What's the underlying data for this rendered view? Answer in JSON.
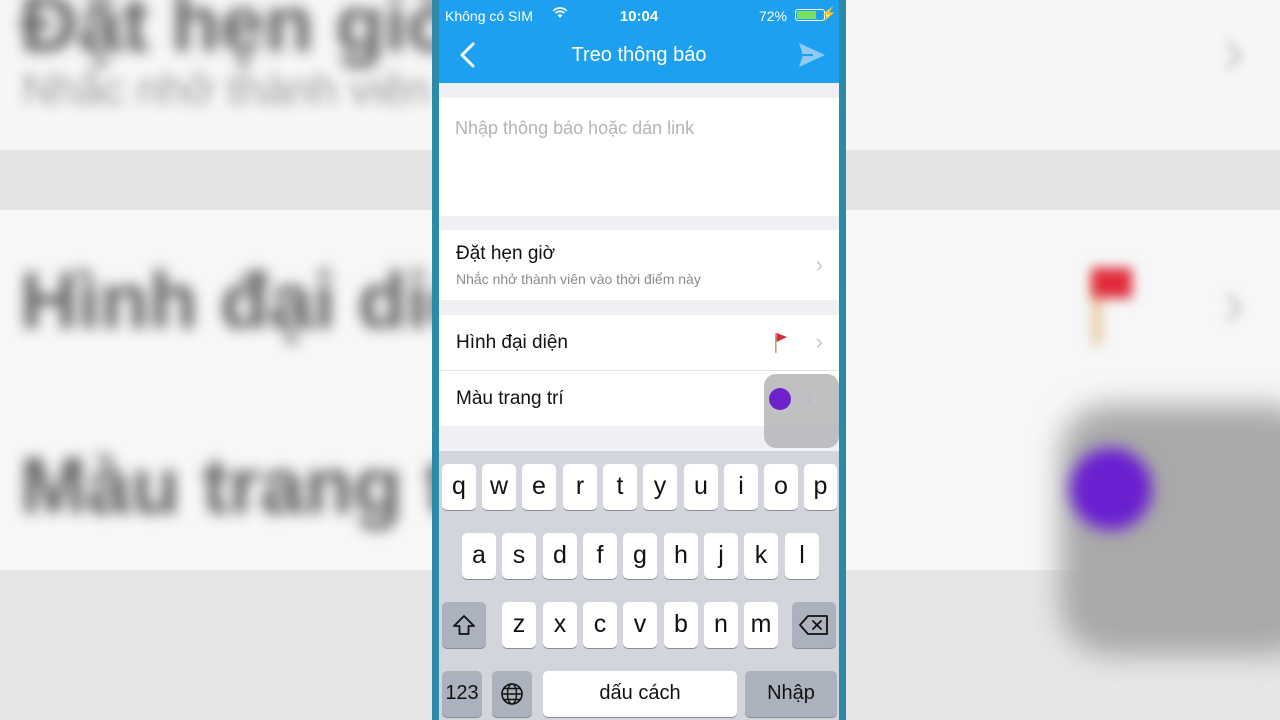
{
  "status_bar": {
    "carrier": "Không có SIM",
    "time": "10:04",
    "battery_percent": "72%",
    "battery_level": 0.72
  },
  "nav": {
    "title": "Treo thông báo",
    "back_icon": "chevron-left-icon",
    "send_icon": "send-icon"
  },
  "composer": {
    "value": "",
    "placeholder": "Nhập thông báo hoặc dán link"
  },
  "settings": {
    "schedule": {
      "label": "Đặt hẹn giờ",
      "sublabel": "Nhắc nhở thành viên vào thời điểm này"
    },
    "avatar": {
      "label": "Hình đại diện",
      "icon": "flag-icon",
      "flag_color": "#e02a3a"
    },
    "decor_color": {
      "label": "Màu trang trí",
      "color": "#6e22cc"
    }
  },
  "keyboard": {
    "row1": [
      "q",
      "w",
      "e",
      "r",
      "t",
      "y",
      "u",
      "i",
      "o",
      "p"
    ],
    "row2": [
      "a",
      "s",
      "d",
      "f",
      "g",
      "h",
      "j",
      "k",
      "l"
    ],
    "row3": [
      "z",
      "x",
      "c",
      "v",
      "b",
      "n",
      "m"
    ],
    "numbers_key": "123",
    "space_key": "dấu cách",
    "return_key": "Nhập"
  },
  "background_mirror": {
    "line1": "Đặt hẹn giờ",
    "line2": "Nhắc nhở thành viên vào thời điểm này",
    "line3": "Hình đại diện",
    "line4": "Màu trang trí"
  },
  "colors": {
    "nav_blue": "#1ea0f0",
    "phone_frame": "#2d8aa6"
  }
}
